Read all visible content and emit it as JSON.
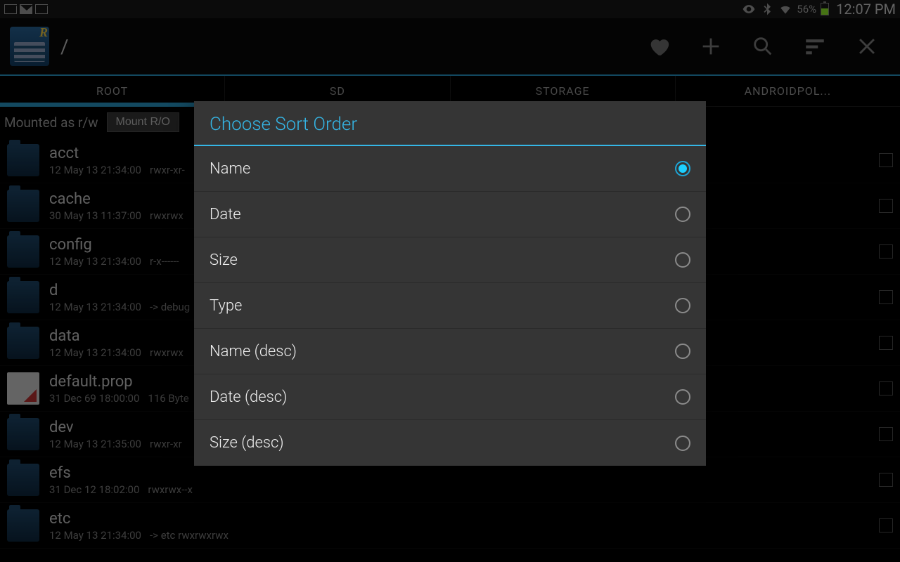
{
  "status": {
    "battery_pct": "56%",
    "clock": "12:07 PM"
  },
  "appbar": {
    "path": "/"
  },
  "tabs": [
    {
      "label": "ROOT",
      "active": true
    },
    {
      "label": "SD",
      "active": false
    },
    {
      "label": "STORAGE",
      "active": false
    },
    {
      "label": "ANDROIDPOL...",
      "active": false
    }
  ],
  "mount": {
    "status": "Mounted as r/w",
    "button": "Mount R/O"
  },
  "files": [
    {
      "name": "acct",
      "date": "12 May 13 21:34:00",
      "perm": "rwxr-xr-",
      "type": "folder"
    },
    {
      "name": "cache",
      "date": "30 May 13 11:37:00",
      "perm": "rwxrwx",
      "type": "folder"
    },
    {
      "name": "config",
      "date": "12 May 13 21:34:00",
      "perm": "r-x------",
      "type": "folder"
    },
    {
      "name": "d",
      "date": "12 May 13 21:34:00",
      "perm": "-> debug",
      "type": "folder"
    },
    {
      "name": "data",
      "date": "12 May 13 21:34:00",
      "perm": "rwxrwx",
      "type": "folder"
    },
    {
      "name": "default.prop",
      "date": "31 Dec 69 18:00:00",
      "perm": "116 Byte",
      "type": "file"
    },
    {
      "name": "dev",
      "date": "12 May 13 21:35:00",
      "perm": "rwxr-xr",
      "type": "folder"
    },
    {
      "name": "efs",
      "date": "31 Dec 12 18:02:00",
      "perm": "rwxrwx--x",
      "type": "folder"
    },
    {
      "name": "etc",
      "date": "12 May 13 21:34:00",
      "perm": "-> etc  rwxrwxrwx",
      "type": "folder"
    }
  ],
  "dialog": {
    "title": "Choose Sort Order",
    "options": [
      {
        "label": "Name",
        "selected": true
      },
      {
        "label": "Date",
        "selected": false
      },
      {
        "label": "Size",
        "selected": false
      },
      {
        "label": "Type",
        "selected": false
      },
      {
        "label": "Name (desc)",
        "selected": false
      },
      {
        "label": "Date (desc)",
        "selected": false
      },
      {
        "label": "Size (desc)",
        "selected": false
      }
    ]
  }
}
